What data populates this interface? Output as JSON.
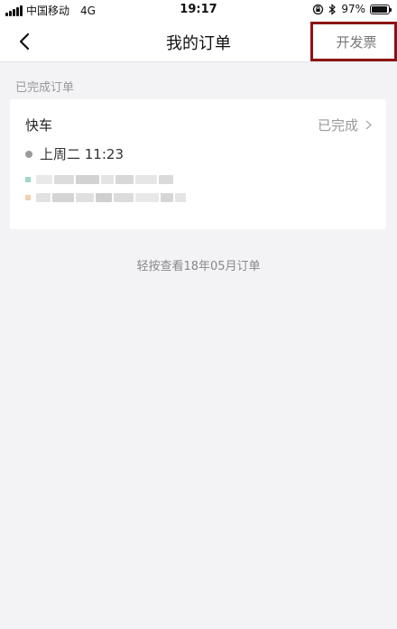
{
  "status_bar": {
    "carrier": "中国移动",
    "network": "4G",
    "time": "19:17",
    "battery_percent_label": "97%",
    "battery_level": 0.97
  },
  "nav": {
    "title": "我的订单",
    "invoice_label": "开发票",
    "highlight_color": "#8c1414"
  },
  "section": {
    "title": "已完成订单"
  },
  "order": {
    "ride_type": "快车",
    "status": "已完成",
    "time": "上周二 11:23"
  },
  "footer": {
    "hint": "轻按查看18年05月订单"
  },
  "icons": {
    "back": "chevron-left-icon",
    "status_chevron": "chevron-right-icon",
    "clock": "clock-dot-icon",
    "lock_rotation": "lock-rotation-icon",
    "bluetooth": "bluetooth-icon"
  }
}
